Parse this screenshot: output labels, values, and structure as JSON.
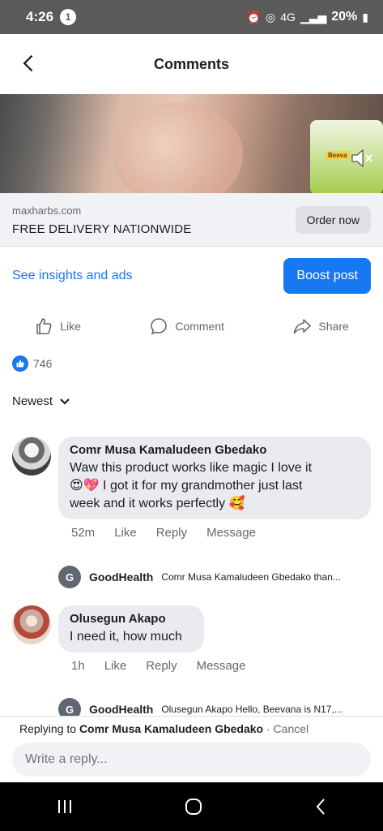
{
  "status_bar": {
    "time": "4:26",
    "notification_count": "1",
    "network": "4G",
    "battery": "20%"
  },
  "header": {
    "title": "Comments",
    "back_icon": "chevron-left-icon"
  },
  "ad": {
    "domain": "maxharbs.com",
    "headline": "FREE DELIVERY NATIONWIDE",
    "cta": "Order now",
    "product_label": "Beeva"
  },
  "insights": {
    "link": "See insights and ads",
    "boost": "Boost post"
  },
  "actions": {
    "like": "Like",
    "comment": "Comment",
    "share": "Share"
  },
  "reactions": {
    "count": "746"
  },
  "sort": {
    "label": "Newest"
  },
  "comments": [
    {
      "name": "Comr Musa Kamaludeen Gbedako",
      "text_line1": "Waw this product works like magic I love it",
      "text_line2": "😍💖 I got it for my  grandmother just last",
      "text_line3": "week and it works  perfectly 🥰",
      "time": "52m",
      "like": "Like",
      "reply": "Reply",
      "message": "Message",
      "reply_preview": {
        "initial": "G",
        "name": "GoodHealth",
        "text": "Comr Musa Kamaludeen Gbedako than..."
      }
    },
    {
      "name": "Olusegun Akapo",
      "text_line1": "I need it, how much",
      "time": "1h",
      "like": "Like",
      "reply": "Reply",
      "message": "Message",
      "reply_preview": {
        "initial": "G",
        "name": "GoodHealth",
        "text": "Olusegun Akapo Hello, Beevana is N17,..."
      }
    }
  ],
  "composer": {
    "replying_prefix": "Replying to",
    "replying_name": "Comr Musa Kamaludeen Gbedako",
    "cancel": "· Cancel",
    "placeholder": "Write a reply..."
  },
  "colors": {
    "accent": "#1877f2",
    "bubble": "#e9ebee",
    "muted": "#65676b"
  }
}
